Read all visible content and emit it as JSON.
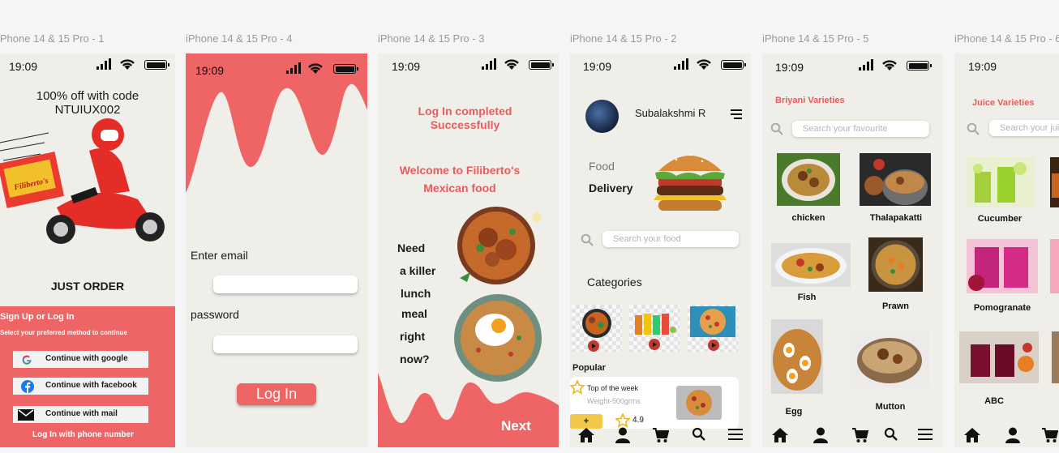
{
  "frames": [
    {
      "label": "iPhone 14 & 15 Pro - 1"
    },
    {
      "label": "iPhone 14 & 15 Pro - 4"
    },
    {
      "label": "iPhone 14 & 15 Pro - 3"
    },
    {
      "label": "iPhone 14 & 15 Pro - 2"
    },
    {
      "label": "iPhone 14 & 15 Pro - 5"
    },
    {
      "label": "iPhone 14 & 15 Pro - 6"
    }
  ],
  "status": {
    "time": "19:09"
  },
  "screen1": {
    "promo": "100% off with code\nNTUIUX002",
    "just_order": "JUST ORDER",
    "box_label": "Filiberto's",
    "signup_title": "Sign Up or Log In",
    "signup_sub": "Select your preferred method to continue",
    "google": "Continue with google",
    "facebook": "Continue with facebook",
    "mail": "Continue with mail",
    "phone": "Log In with phone number"
  },
  "screen4": {
    "email_label": "Enter email",
    "password_label": "password",
    "login": "Log In"
  },
  "screen3": {
    "success": "Log In completed\nSuccessfully",
    "welcome": "Welcome to Filiberto's\nMexican food",
    "tagline": [
      "Need",
      "a killer",
      "lunch",
      "meal",
      "right",
      "now?"
    ],
    "next": "Next"
  },
  "screen2": {
    "user": "Subalakshmi R",
    "food": "Food",
    "delivery": "Delivery",
    "search_placeholder": "Search your food",
    "categories": "Categories",
    "popular": "Popular",
    "top": "Top of the week",
    "weight": "Weight-500grms",
    "add": "+",
    "rating": "4.9"
  },
  "screen5": {
    "title": "Briyani Varieties",
    "search_placeholder": "Search your favourite",
    "items": [
      "chicken",
      "Thalapakatti",
      "Fish",
      "Prawn",
      "Egg",
      "Mutton"
    ]
  },
  "screen6": {
    "title": "Juice Varieties",
    "search_placeholder": "Search your juice",
    "items": [
      "Cucumber",
      "Pomogranate",
      "ABC"
    ]
  },
  "colors": {
    "accent": "#ea5b5b",
    "bg": "#efeee9",
    "highlight": "#f2c74a"
  }
}
